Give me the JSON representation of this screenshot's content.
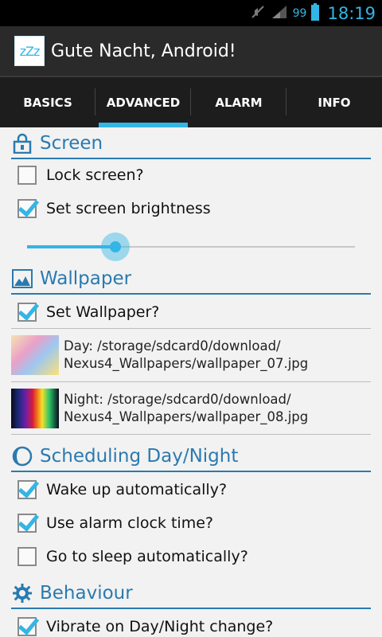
{
  "status_bar": {
    "battery": "99",
    "time": "18:19"
  },
  "action_bar": {
    "app_icon_text": "zZz",
    "title": "Gute Nacht, Android!"
  },
  "tabs": [
    {
      "label": "BASICS",
      "active": false
    },
    {
      "label": "ADVANCED",
      "active": true
    },
    {
      "label": "ALARM",
      "active": false
    },
    {
      "label": "INFO",
      "active": false
    }
  ],
  "sections": {
    "screen": {
      "title": "Screen",
      "lock_screen": {
        "label": "Lock screen?",
        "checked": false
      },
      "set_brightness": {
        "label": "Set screen brightness",
        "checked": true
      },
      "brightness_level": 0.27
    },
    "wallpaper": {
      "title": "Wallpaper",
      "set_wallpaper": {
        "label": "Set Wallpaper?",
        "checked": true
      },
      "day": {
        "line1": "Day: /storage/sdcard0/download/",
        "line2": "Nexus4_Wallpapers/wallpaper_07.jpg"
      },
      "night": {
        "line1": "Night: /storage/sdcard0/download/",
        "line2": "Nexus4_Wallpapers/wallpaper_08.jpg"
      }
    },
    "scheduling": {
      "title": "Scheduling Day/Night",
      "wake_up": {
        "label": "Wake up automatically?",
        "checked": true
      },
      "use_alarm": {
        "label": "Use alarm clock time?",
        "checked": true
      },
      "go_sleep": {
        "label": "Go to sleep automatically?",
        "checked": false
      }
    },
    "behaviour": {
      "title": "Behaviour",
      "vibrate": {
        "label": "Vibrate on Day/Night change?",
        "checked": true
      }
    }
  },
  "colors": {
    "accent": "#33b5e5",
    "section_title": "#2a7ab0"
  }
}
